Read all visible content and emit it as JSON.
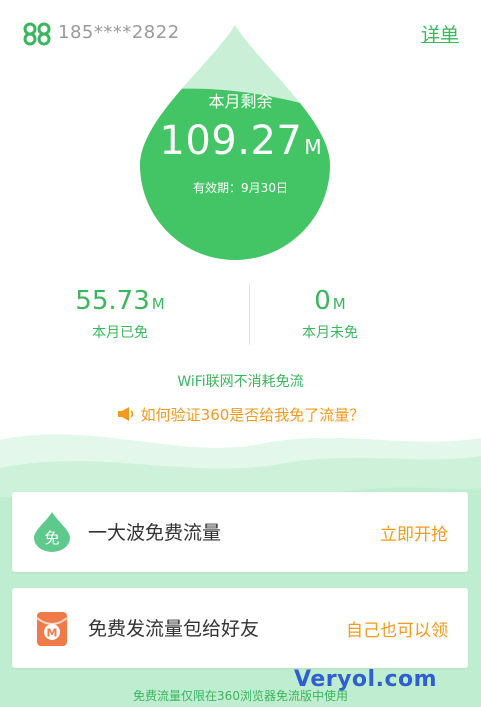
{
  "header": {
    "phone": "185****2822",
    "detail_label": "详单"
  },
  "drop": {
    "title": "本月剩余",
    "value": "109.27",
    "unit": "M",
    "expire": "有效期：9月30日"
  },
  "stats": [
    {
      "value": "55.73",
      "unit": "M",
      "label": "本月已免"
    },
    {
      "value": "0",
      "unit": "M",
      "label": "本月未免"
    }
  ],
  "wifi_note": "WiFi联网不消耗免流",
  "verify_link": "如何验证360是否给我免了流量？",
  "cards": [
    {
      "icon_char": "免",
      "title": "一大波免费流量",
      "action": "立即开抢"
    },
    {
      "icon_char": "M",
      "title": "免费发流量包给好友",
      "action": "自己也可以领"
    }
  ],
  "footer_note": "免费流量仅限在360浏览器免流版中使用",
  "watermark": "Veryol.com",
  "colors": {
    "primary_green": "#3bb55e",
    "accent_orange": "#f39a1c",
    "light_green": "#c9f0d6"
  }
}
